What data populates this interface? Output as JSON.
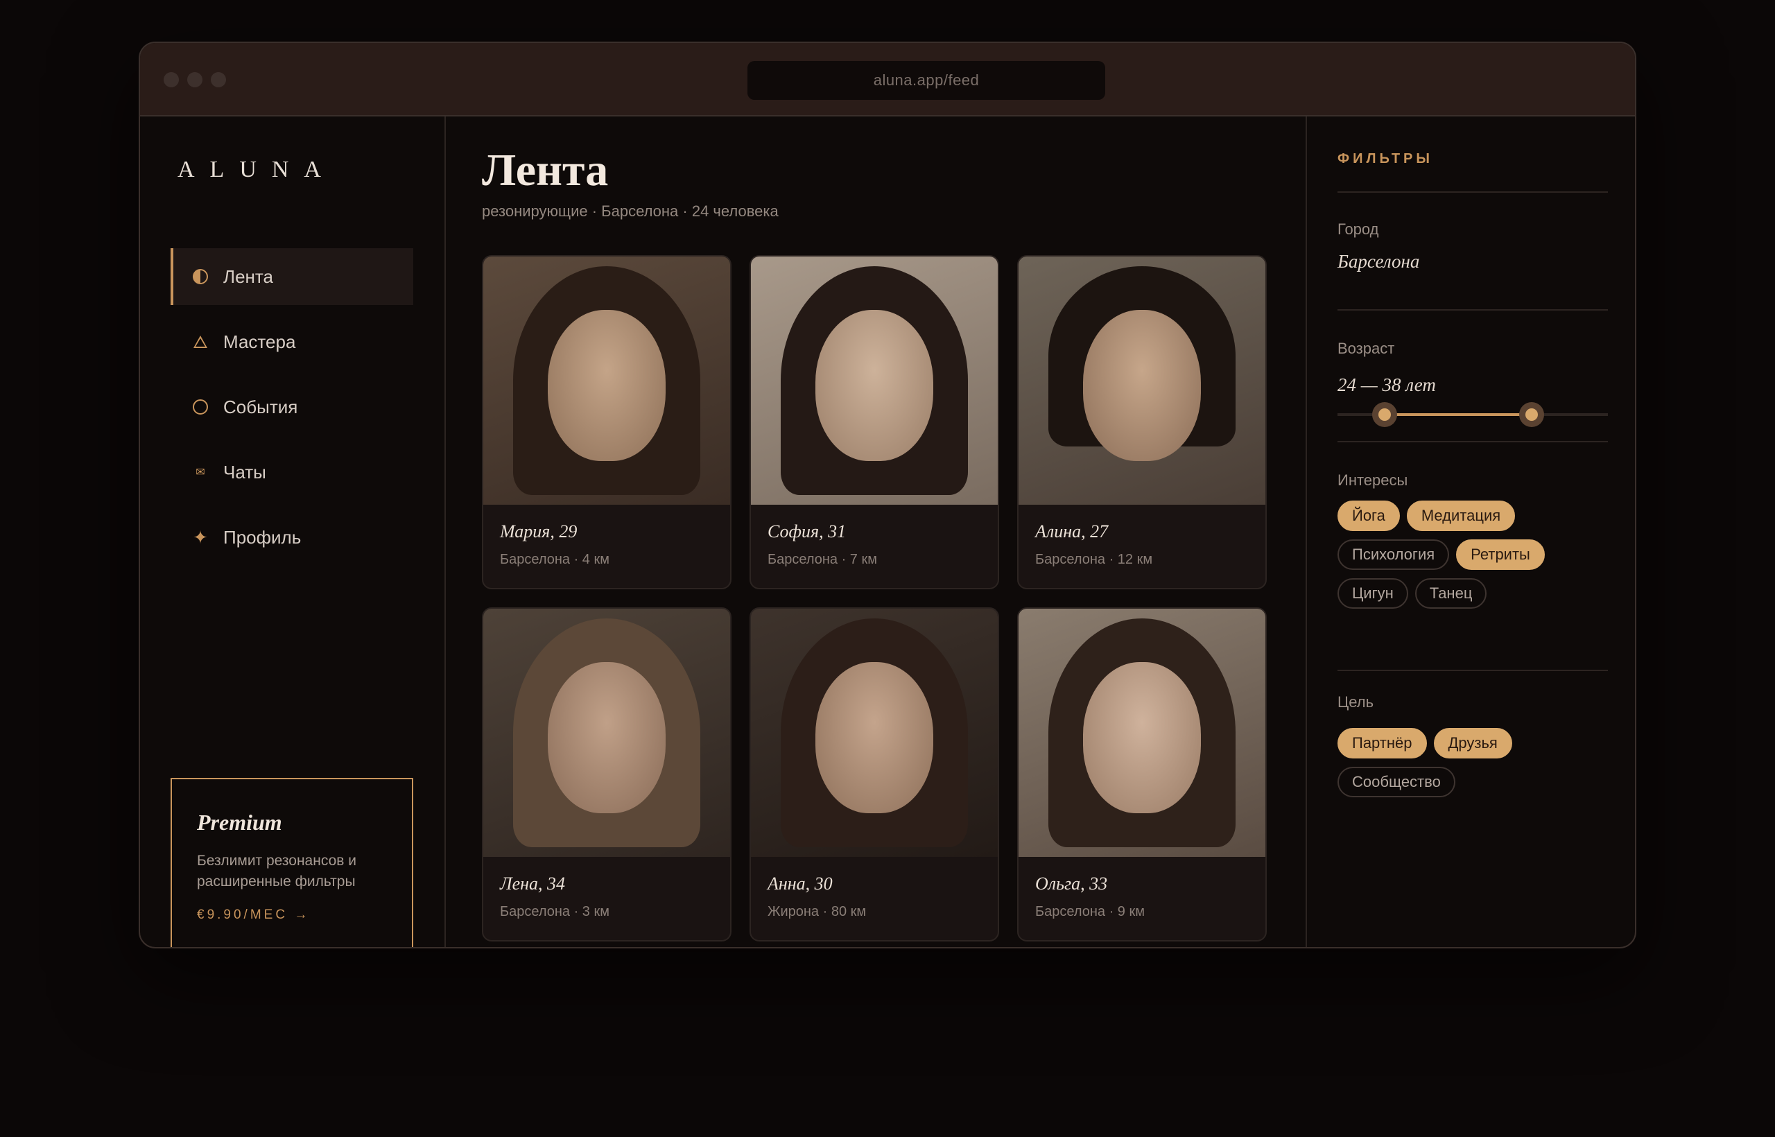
{
  "browser": {
    "url": "aluna.app/feed"
  },
  "brand": {
    "logo": "ALUNA",
    "accent": "#c9955c"
  },
  "nav": {
    "items": [
      {
        "label": "Лента",
        "icon": "half-moon-icon",
        "active": true
      },
      {
        "label": "Мастера",
        "icon": "triangle-icon",
        "active": false
      },
      {
        "label": "События",
        "icon": "circle-icon",
        "active": false
      },
      {
        "label": "Чаты",
        "icon": "envelope-icon",
        "active": false
      },
      {
        "label": "Профиль",
        "icon": "sparkle-icon",
        "active": false
      }
    ]
  },
  "premium": {
    "title": "Premium",
    "description": "Безлимит резонансов и расширенные фильтры",
    "price": "€9.90/МЕС →"
  },
  "feed": {
    "title": "Лента",
    "subtitle": "резонирующие · Барселона · 24 человека",
    "profiles": [
      {
        "name": "Мария, 29",
        "location": "Барселона · 4 км"
      },
      {
        "name": "София, 31",
        "location": "Барселона · 7 км"
      },
      {
        "name": "Алина, 27",
        "location": "Барселона · 12 км"
      },
      {
        "name": "Лена, 34",
        "location": "Барселона · 3 км"
      },
      {
        "name": "Анна, 30",
        "location": "Жирона · 80 км"
      },
      {
        "name": "Ольга, 33",
        "location": "Барселона · 9 км"
      }
    ]
  },
  "filters": {
    "heading": "ФИЛЬТРЫ",
    "city": {
      "label": "Город",
      "value": "Барселона"
    },
    "age": {
      "label": "Возраст",
      "value": "24 — 38 лет",
      "min": 24,
      "max": 38
    },
    "interests": {
      "label": "Интересы",
      "chips": [
        {
          "label": "Йога",
          "selected": true
        },
        {
          "label": "Медитация",
          "selected": true
        },
        {
          "label": "Психология",
          "selected": false
        },
        {
          "label": "Ретриты",
          "selected": true
        },
        {
          "label": "Цигун",
          "selected": false
        },
        {
          "label": "Танец",
          "selected": false
        }
      ]
    },
    "goal": {
      "label": "Цель",
      "chips": [
        {
          "label": "Партнёр",
          "selected": true
        },
        {
          "label": "Друзья",
          "selected": true
        },
        {
          "label": "Сообщество",
          "selected": false
        }
      ]
    }
  }
}
